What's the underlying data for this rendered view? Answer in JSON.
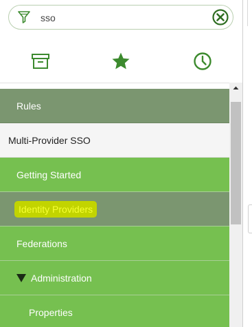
{
  "search": {
    "value": "sso",
    "placeholder": ""
  },
  "tabs": [
    {
      "icon": "archive-icon"
    },
    {
      "icon": "star-icon"
    },
    {
      "icon": "clock-icon"
    }
  ],
  "tree": {
    "items": [
      {
        "label": "Rules",
        "style": "dark"
      },
      {
        "label": "Multi-Provider SSO",
        "style": "white"
      },
      {
        "label": "Getting Started",
        "style": "green"
      },
      {
        "label": "Identity Providers",
        "style": "highlighted"
      },
      {
        "label": "Federations",
        "style": "green"
      },
      {
        "label": "Administration",
        "style": "green",
        "expanded": true
      },
      {
        "label": "Properties",
        "style": "green"
      }
    ]
  },
  "colors": {
    "green": "#76c050",
    "dark_green": "#7b9670",
    "highlight": "#c2d400",
    "icon_green": "#3c8a2e"
  }
}
